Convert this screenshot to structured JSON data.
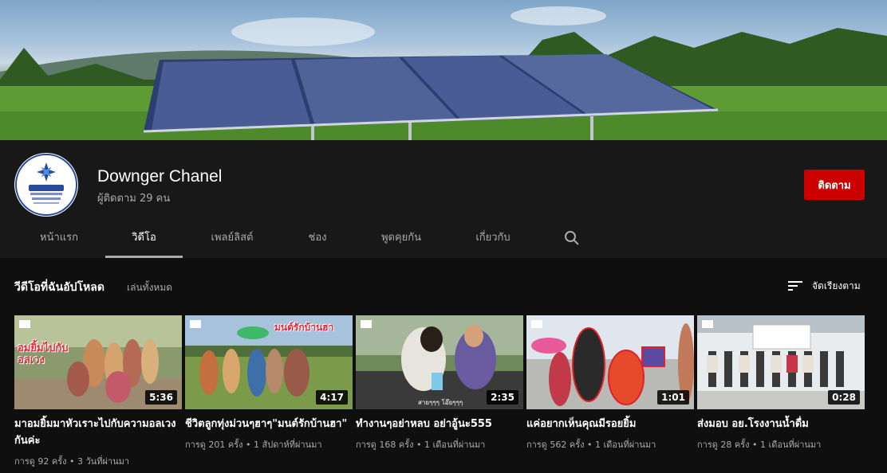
{
  "channel": {
    "name": "Downger Chanel",
    "subscribers": "ผู้ติดตาม 29 คน",
    "subscribe_label": "ติดตาม"
  },
  "tabs": [
    {
      "label": "หน้าแรก"
    },
    {
      "label": "วิดีโอ",
      "active": true
    },
    {
      "label": "เพลย์ลิสต์"
    },
    {
      "label": "ช่อง"
    },
    {
      "label": "พูดคุยกัน"
    },
    {
      "label": "เกี่ยวกับ"
    }
  ],
  "shelf": {
    "title": "วีดีโอที่ฉันอัปโหลด",
    "play_all": "เล่นทั้งหมด",
    "sort_label": "จัดเรียงตาม"
  },
  "videos": [
    {
      "title": "มาอมยิ้มมาหัวเราะไปกับความอลเวงกันค่ะ",
      "duration": "5:36",
      "meta": "การดู 92 ครั้ง • 3 วันที่ผ่านมา"
    },
    {
      "title": "ชีวิตลูกทุ่งม่วนๆฮาๆ\"มนต์รักบ้านฮา\"",
      "duration": "4:17",
      "meta": "การดู 201 ครั้ง • 1 สัปดาห์ที่ผ่านมา"
    },
    {
      "title": "ทำงานๆอย่าหลบ อย่าอู้นะ555",
      "duration": "2:35",
      "meta": "การดู 168 ครั้ง • 1 เดือนที่ผ่านมา"
    },
    {
      "title": "แค่อยากเห็นคุณมีรอยยิ้ม",
      "duration": "1:01",
      "meta": "การดู 562 ครั้ง • 1 เดือนที่ผ่านมา"
    },
    {
      "title": "ส่งมอบ อย.โรงงานน้ำดื่ม",
      "duration": "0:28",
      "meta": "การดู 28 ครั้ง • 1 เดือนที่ผ่านมา"
    }
  ],
  "thumb_text": {
    "v1_overlay": "อมยิ้มไปกับ อลเวง",
    "v2_overlay": "มนต์รักบ้านฮา",
    "v3_overlay": "สายๆๆๆ โอ๊ยๆๆๆ"
  },
  "icons": {
    "search": "search-icon",
    "sort": "sort-icon"
  },
  "colors": {
    "subscribe": "#cc0000",
    "background": "#181818",
    "content_bg": "#0f0f0f"
  }
}
